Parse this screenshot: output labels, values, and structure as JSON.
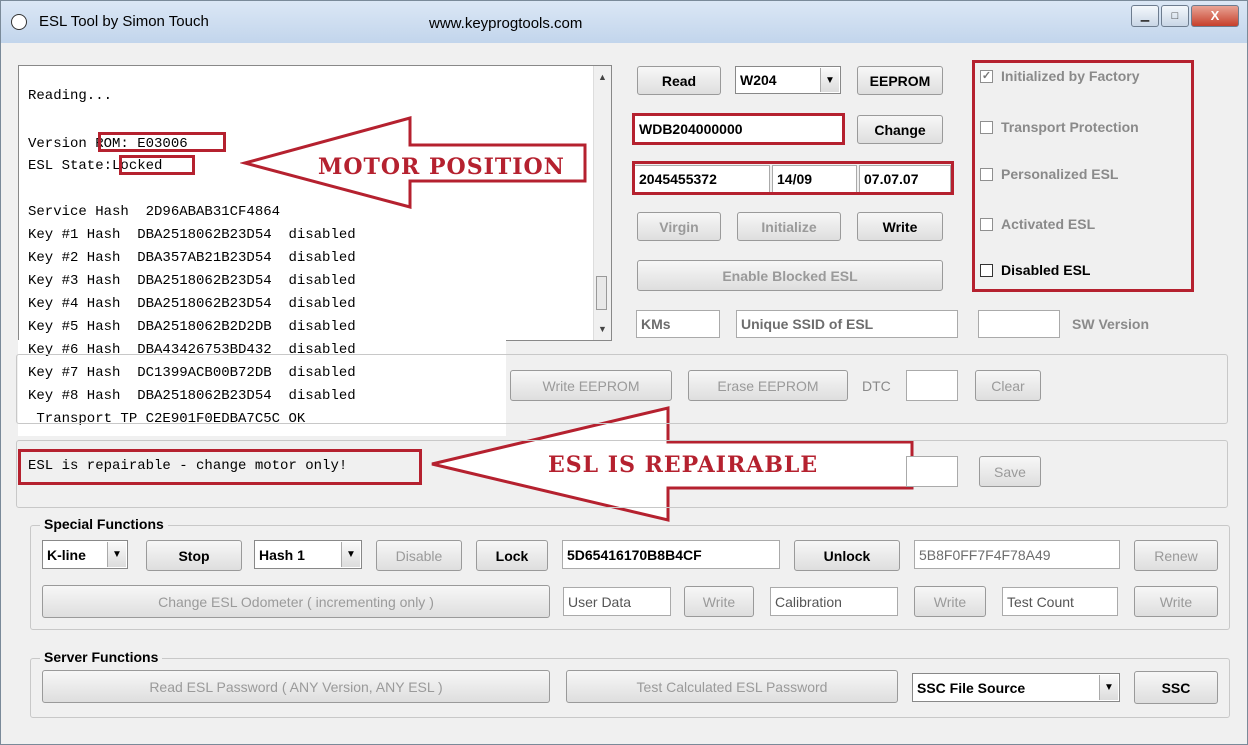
{
  "window": {
    "title": "ESL Tool by Simon Touch",
    "url": "www.keyprogtools.com"
  },
  "log": {
    "lines": [
      "Reading...",
      "Version ROM: E03006",
      "ESL State:Locked",
      "Service Hash  2D96ABAB31CF4864",
      "Key #1 Hash  DBA2518062B23D54  disabled",
      "Key #2 Hash  DBA357AB21B23D54  disabled",
      "Key #3 Hash  DBA2518062B23D54  disabled",
      "Key #4 Hash  DBA2518062B23D54  disabled",
      "Key #5 Hash  DBA2518062B2D2DB  disabled",
      "Key #6 Hash  DBA43426753BD432  disabled",
      "Key #7 Hash  DC1399ACB00B72DB  disabled",
      "Key #8 Hash  DBA2518062B23D54  disabled",
      " Transport TP C2E901F0EDBA7C5C OK",
      "ESL is repairable - change motor only!"
    ]
  },
  "annotations": {
    "motor_position": "MOTOR POSITION",
    "esl_repairable": "ESL IS REPAIRABLE"
  },
  "top": {
    "read": "Read",
    "model": "W204",
    "eeprom": "EEPROM",
    "vin": "WDB204000000",
    "change": "Change",
    "part_no": "2045455372",
    "date1": "14/09",
    "date2": "07.07.07",
    "virgin": "Virgin",
    "initialize": "Initialize",
    "write": "Write",
    "enable_blocked": "Enable Blocked ESL",
    "kms": "KMs",
    "ssid": "Unique SSID of ESL",
    "sw_version": "SW Version"
  },
  "checks": [
    {
      "label": "Initialized by Factory",
      "checked": true
    },
    {
      "label": "Transport Protection",
      "checked": false
    },
    {
      "label": "Personalized ESL",
      "checked": false
    },
    {
      "label": "Activated ESL",
      "checked": false
    },
    {
      "label": "Disabled ESL",
      "checked": false
    }
  ],
  "mid": {
    "write_eeprom": "Write EEPROM",
    "erase_eeprom": "Erase EEPROM",
    "dtc": "DTC",
    "clear": "Clear",
    "save": "Save"
  },
  "special": {
    "title": "Special Functions",
    "kline": "K-line",
    "stop": "Stop",
    "hash": "Hash 1",
    "disable": "Disable",
    "lock": "Lock",
    "hash_value": "5D65416170B8B4CF",
    "unlock": "Unlock",
    "unlock_value": "5B8F0FF7F4F78A49",
    "renew": "Renew",
    "odometer": "Change ESL Odometer ( incrementing only )",
    "user_data": "User Data",
    "write": "Write",
    "calibration": "Calibration",
    "test_count": "Test Count"
  },
  "server": {
    "title": "Server Functions",
    "read_pw": "Read ESL Password ( ANY Version, ANY ESL )",
    "test_pw": "Test Calculated ESL Password",
    "ssc_source": "SSC File Source",
    "ssc": "SSC"
  }
}
